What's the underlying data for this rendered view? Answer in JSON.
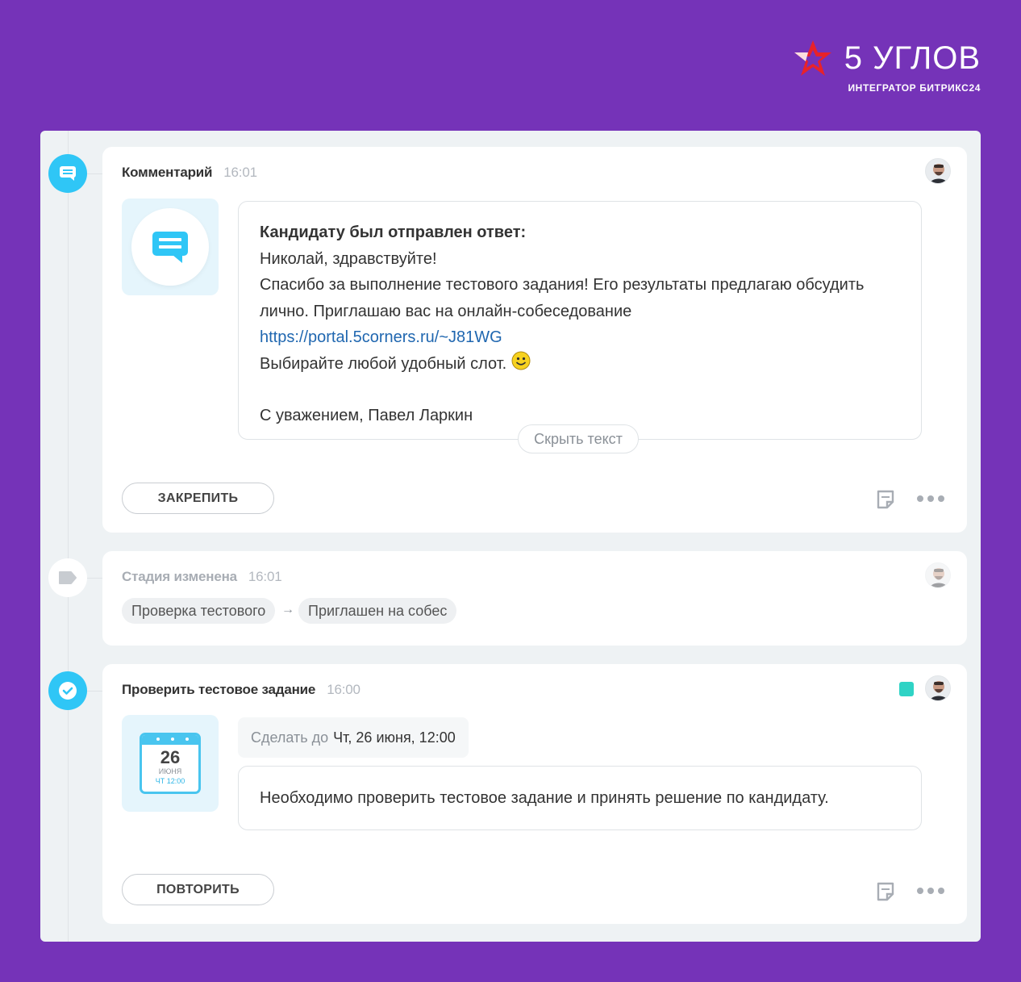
{
  "logo": {
    "name": "5 УГЛОВ",
    "tagline": "ИНТЕГРАТОР БИТРИКС24"
  },
  "colors": {
    "background": "#7533b8",
    "accent": "#2fc6f6",
    "link": "#2067b0",
    "status": "#2fd3c5"
  },
  "timeline": [
    {
      "type": "comment",
      "icon": "comment-icon",
      "title": "Комментарий",
      "time": "16:01",
      "message": {
        "heading": "Кандидату был отправлен ответ:",
        "greeting": "Николай, здравствуйте!",
        "body": "Спасибо за выполнение тестового задания! Его результаты предлагаю обсудить лично. Приглашаю вас на онлайн-собеседование",
        "link": "https://portal.5corners.ru/~J81WG",
        "closing_line": "Выбирайте любой удобный слот.",
        "signature": "С уважением, Павел Ларкин"
      },
      "hide_label": "Скрыть текст",
      "action_label": "ЗАКРЕПИТЬ"
    },
    {
      "type": "stage",
      "icon": "tag-icon",
      "title": "Стадия изменена",
      "time": "16:01",
      "from": "Проверка тестового",
      "arrow": "→",
      "to": "Приглашен на собес"
    },
    {
      "type": "task",
      "icon": "check-icon",
      "title": "Проверить тестовое задание",
      "time": "16:00",
      "calendar": {
        "day": "26",
        "month": "июня",
        "time": "ЧТ 12:00"
      },
      "deadline_label": "Сделать до",
      "deadline_value": "Чт, 26 июня, 12:00",
      "description": "Необходимо проверить тестовое задание и принять решение по кандидату.",
      "action_label": "ПОВТОРИТЬ"
    }
  ]
}
